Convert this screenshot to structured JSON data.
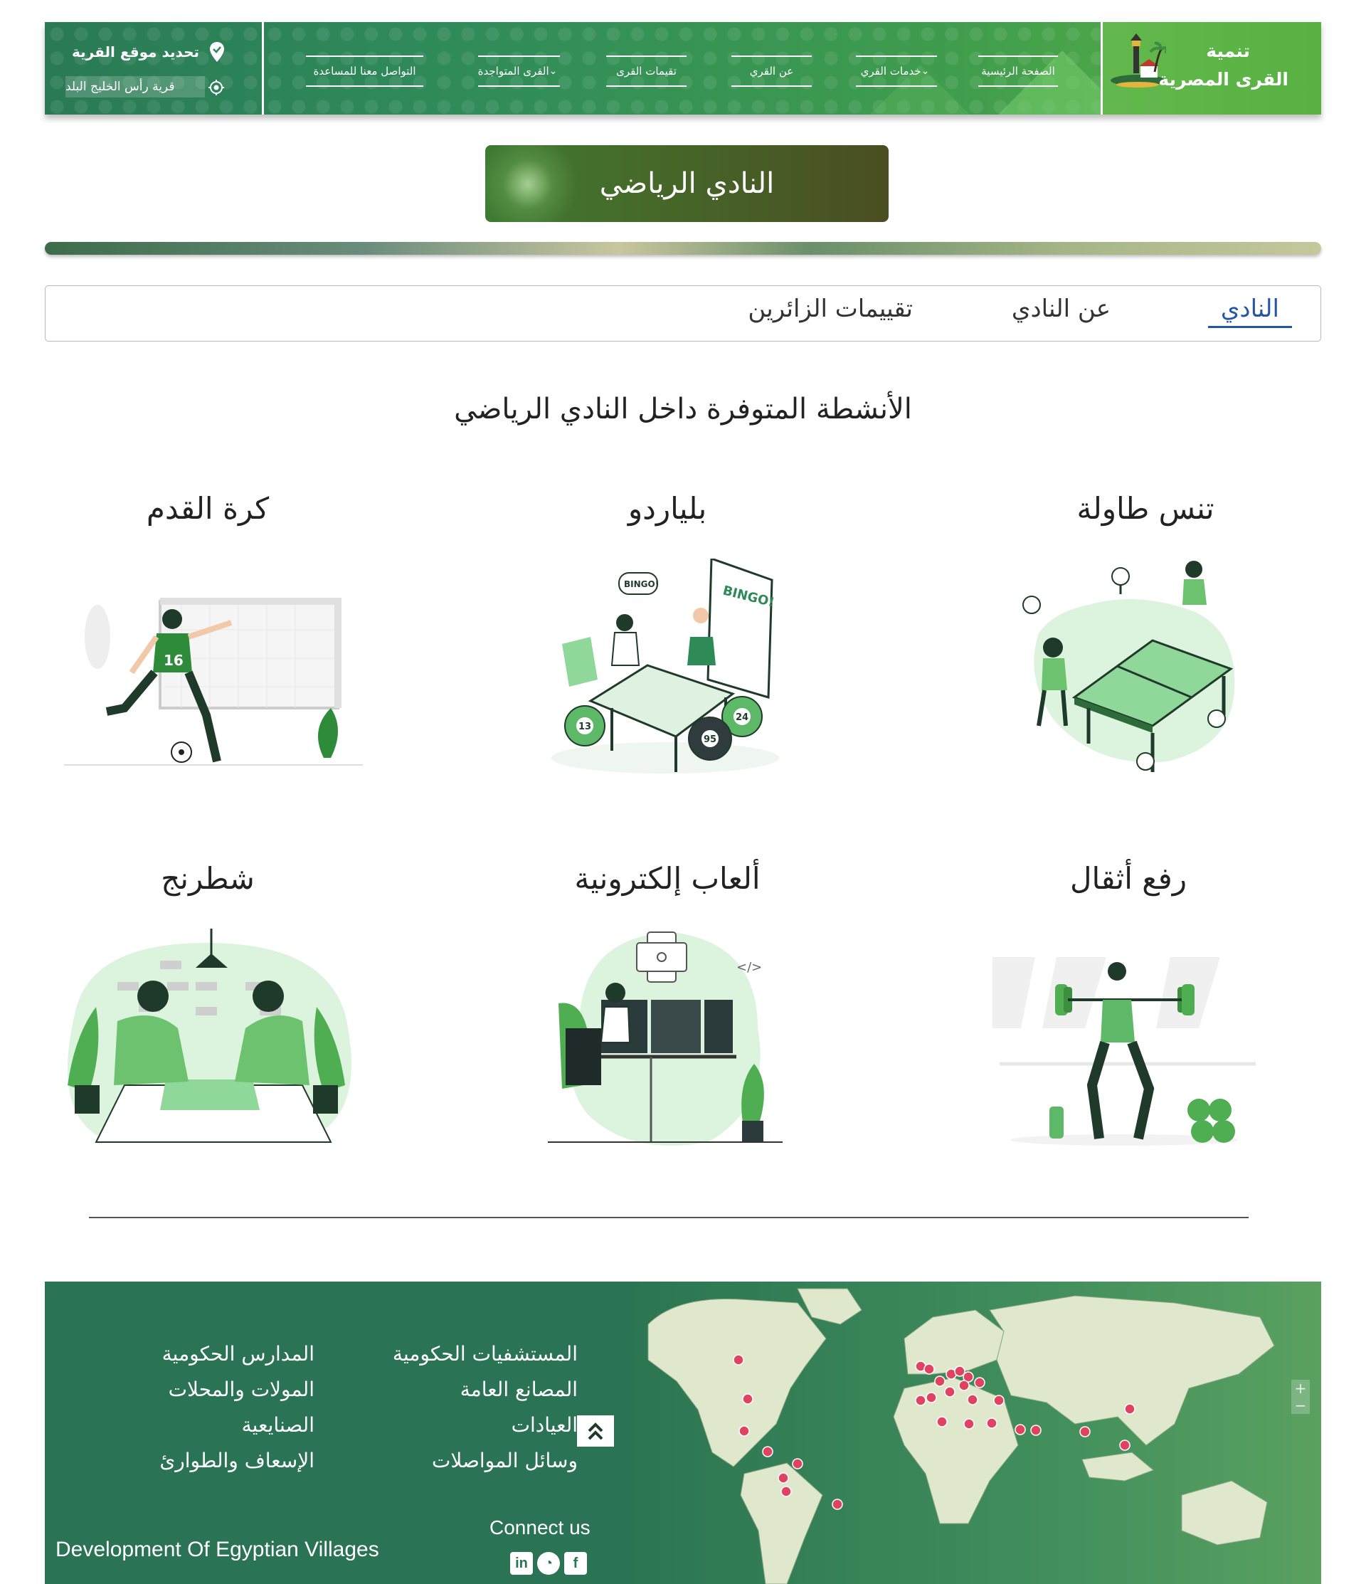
{
  "nav": {
    "brand_line1": "تنمية",
    "brand_line2": "القرى المصرية",
    "links": [
      {
        "label": "الصفحة الرئيسية",
        "dropdown": false
      },
      {
        "label": "خدمات القري",
        "dropdown": true
      },
      {
        "label": "عن القري",
        "dropdown": false
      },
      {
        "label": "تقيمات القرى",
        "dropdown": false
      },
      {
        "label": "القرى المتواجدة",
        "dropdown": true
      },
      {
        "label": "التواصل معنا للمساعدة",
        "dropdown": false
      }
    ],
    "location_title": "تحديد موقع القرية",
    "location_value": "قرية رأس الخليج البلد",
    "chevron_glyph": "⌄"
  },
  "banner": {
    "title": "النادي الرياضي"
  },
  "tabs": [
    {
      "label": "النادي",
      "active": true
    },
    {
      "label": "عن النادي",
      "active": false
    },
    {
      "label": "تقييمات الزائرين",
      "active": false
    }
  ],
  "section_title": "الأنشطة المتوفرة داخل النادي الرياضي",
  "activities": [
    {
      "label": "تنس طاولة",
      "icon": "table-tennis-illustration"
    },
    {
      "label": "بلياردو",
      "icon": "billiards-illustration"
    },
    {
      "label": "كرة القدم",
      "icon": "football-illustration"
    },
    {
      "label": "رفع أثقال",
      "icon": "weightlifting-illustration"
    },
    {
      "label": "ألعاب إلكترونية",
      "icon": "gaming-illustration"
    },
    {
      "label": "شطرنج",
      "icon": "chess-illustration"
    }
  ],
  "illustration_text": {
    "bingo": "BINGO!",
    "ball_13": "13",
    "ball_24": "24",
    "ball_95": "95",
    "jersey": "16",
    "code_tag": "</>"
  },
  "footer": {
    "col1": [
      "المستشفيات الحكومية",
      "المصانع العامة",
      "العيادات",
      "وسائل المواصلات"
    ],
    "col2": [
      "المدارس الحكومية",
      "المولات والمحلات",
      "الصنايعية",
      "الإسعاف والطوارئ"
    ],
    "connect": "Connect us",
    "tagline": "Development Of Egyptian Villages",
    "social": [
      "linkedin-icon",
      "whatsapp-icon",
      "facebook-icon"
    ],
    "social_glyphs": {
      "linkedin": "in",
      "whatsapp": "◔",
      "facebook": "f"
    },
    "zoom_in": "+",
    "zoom_out": "−"
  },
  "colors": {
    "primary_green": "#2a7354",
    "accent_green": "#59b043",
    "tab_active": "#2456a8",
    "map_marker": "#e0435f",
    "illustration_green": "#4caf50"
  }
}
